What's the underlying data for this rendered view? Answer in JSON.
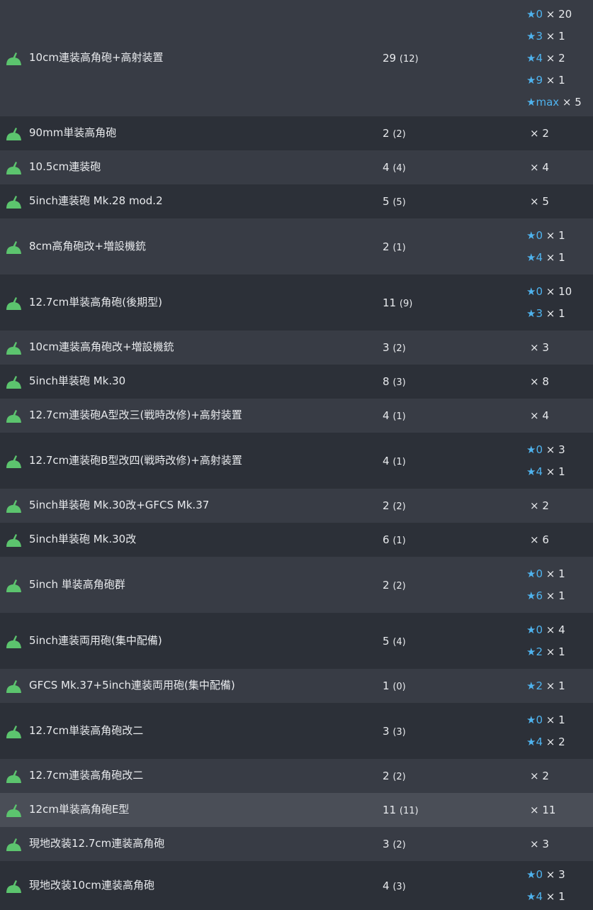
{
  "equipment": [
    {
      "name": "10cm連装高角砲+高射装置",
      "total": "29",
      "unlocked": "(12)",
      "improvements": [
        {
          "star": "★",
          "level": "0",
          "count": "× 20"
        },
        {
          "star": "★",
          "level": "3",
          "count": "× 1"
        },
        {
          "star": "★",
          "level": "4",
          "count": "× 2"
        },
        {
          "star": "★",
          "level": "9",
          "count": "× 1"
        },
        {
          "star": "★",
          "level": "max",
          "count": "× 5"
        }
      ]
    },
    {
      "name": "90mm単装高角砲",
      "total": "2",
      "unlocked": "(2)",
      "plain": "× 2"
    },
    {
      "name": "10.5cm連装砲",
      "total": "4",
      "unlocked": "(4)",
      "plain": "× 4"
    },
    {
      "name": "5inch連装砲 Mk.28 mod.2",
      "total": "5",
      "unlocked": "(5)",
      "plain": "× 5"
    },
    {
      "name": "8cm高角砲改+増設機銃",
      "total": "2",
      "unlocked": "(1)",
      "improvements": [
        {
          "star": "★",
          "level": "0",
          "count": "× 1"
        },
        {
          "star": "★",
          "level": "4",
          "count": "× 1"
        }
      ]
    },
    {
      "name": "12.7cm単装高角砲(後期型)",
      "total": "11",
      "unlocked": "(9)",
      "improvements": [
        {
          "star": "★",
          "level": "0",
          "count": "× 10"
        },
        {
          "star": "★",
          "level": "3",
          "count": "× 1"
        }
      ]
    },
    {
      "name": "10cm連装高角砲改+増設機銃",
      "total": "3",
      "unlocked": "(2)",
      "plain": "× 3"
    },
    {
      "name": "5inch単装砲 Mk.30",
      "total": "8",
      "unlocked": "(3)",
      "plain": "× 8"
    },
    {
      "name": "12.7cm連装砲A型改三(戦時改修)+高射装置",
      "total": "4",
      "unlocked": "(1)",
      "plain": "× 4"
    },
    {
      "name": "12.7cm連装砲B型改四(戦時改修)+高射装置",
      "total": "4",
      "unlocked": "(1)",
      "improvements": [
        {
          "star": "★",
          "level": "0",
          "count": "× 3"
        },
        {
          "star": "★",
          "level": "4",
          "count": "× 1"
        }
      ]
    },
    {
      "name": "5inch単装砲 Mk.30改+GFCS Mk.37",
      "total": "2",
      "unlocked": "(2)",
      "plain": "× 2"
    },
    {
      "name": "5inch単装砲 Mk.30改",
      "total": "6",
      "unlocked": "(1)",
      "plain": "× 6"
    },
    {
      "name": "5inch 単装高角砲群",
      "total": "2",
      "unlocked": "(2)",
      "improvements": [
        {
          "star": "★",
          "level": "0",
          "count": "× 1"
        },
        {
          "star": "★",
          "level": "6",
          "count": "× 1"
        }
      ]
    },
    {
      "name": "5inch連装両用砲(集中配備)",
      "total": "5",
      "unlocked": "(4)",
      "improvements": [
        {
          "star": "★",
          "level": "0",
          "count": "× 4"
        },
        {
          "star": "★",
          "level": "2",
          "count": "× 1"
        }
      ]
    },
    {
      "name": "GFCS Mk.37+5inch連装両用砲(集中配備)",
      "total": "1",
      "unlocked": "(0)",
      "improvements": [
        {
          "star": "★",
          "level": "2",
          "count": "× 1"
        }
      ]
    },
    {
      "name": "12.7cm単装高角砲改二",
      "total": "3",
      "unlocked": "(3)",
      "improvements": [
        {
          "star": "★",
          "level": "0",
          "count": "× 1"
        },
        {
          "star": "★",
          "level": "4",
          "count": "× 2"
        }
      ]
    },
    {
      "name": "12.7cm連装高角砲改二",
      "total": "2",
      "unlocked": "(2)",
      "plain": "× 2"
    },
    {
      "name": "12cm単装高角砲E型",
      "total": "11",
      "unlocked": "(11)",
      "plain": "× 11",
      "highlighted": true
    },
    {
      "name": "現地改装12.7cm連装高角砲",
      "total": "3",
      "unlocked": "(2)",
      "plain": "× 3"
    },
    {
      "name": "現地改装10cm連装高角砲",
      "total": "4",
      "unlocked": "(3)",
      "improvements": [
        {
          "star": "★",
          "level": "0",
          "count": "× 3"
        },
        {
          "star": "★",
          "level": "4",
          "count": "× 1"
        }
      ]
    }
  ],
  "colors": {
    "icon_green": "#5cc46e",
    "level_blue": "#4fb3ee"
  },
  "icon": "aa-gun-icon"
}
